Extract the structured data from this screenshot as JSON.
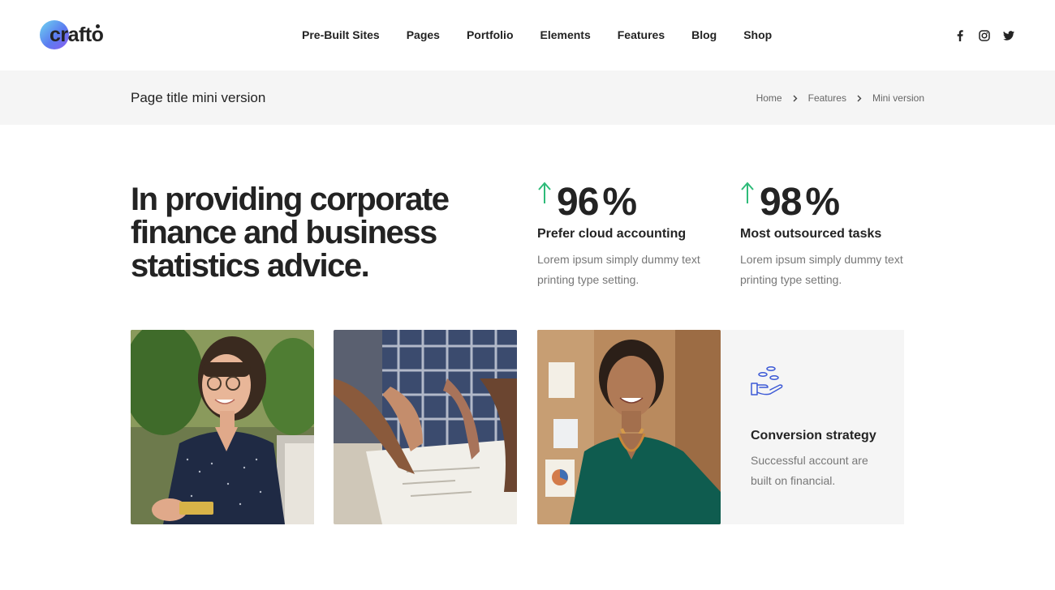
{
  "brand": {
    "name": "crafto"
  },
  "nav": {
    "items": [
      "Pre-Built Sites",
      "Pages",
      "Portfolio",
      "Elements",
      "Features",
      "Blog",
      "Shop"
    ]
  },
  "social": [
    "facebook-icon",
    "instagram-icon",
    "twitter-icon"
  ],
  "titlebar": {
    "title": "Page title mini version",
    "breadcrumb": [
      "Home",
      "Features",
      "Mini version"
    ]
  },
  "hero": {
    "headline": "In providing corporate finance and business statistics advice."
  },
  "stats": [
    {
      "value": "96",
      "unit": "%",
      "title": "Prefer cloud accounting",
      "text": "Lorem ipsum simply dummy text printing type setting."
    },
    {
      "value": "98",
      "unit": "%",
      "title": "Most outsourced tasks",
      "text": "Lorem ipsum simply dummy text printing type setting."
    }
  ],
  "feature": {
    "icon": "hand-coins-icon",
    "title": "Conversion strategy",
    "text": "Successful account are built on financial."
  },
  "colors": {
    "accent_green": "#2ebb79",
    "icon_blue": "#3d5ad6",
    "titlebar_bg": "#f5f5f5"
  }
}
